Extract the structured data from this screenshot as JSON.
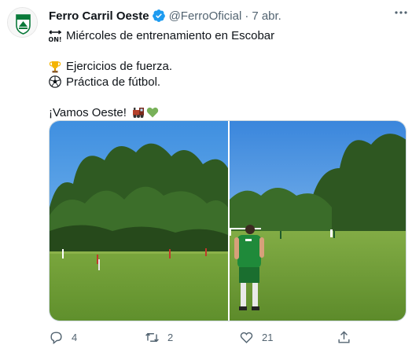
{
  "tweet": {
    "author_name": "Ferro Carril Oeste",
    "handle": "@FerroOficial",
    "separator": "·",
    "time": "7 abr.",
    "avatar_icon": "ferro-carril-oeste-crest",
    "verified_icon": "verified-badge-icon",
    "line1": "Miércoles de entrenamiento en Escobar",
    "line1_icon": "on-arrow-emoji",
    "line2": "Ejercicios de fuerza.",
    "line2_icon": "trophy-emoji",
    "line3": "Práctica de fútbol.",
    "line3_icon": "soccer-ball-emoji",
    "line4": "¡Vamos Oeste!",
    "line4_icons": [
      "locomotive-emoji",
      "green-heart-emoji"
    ]
  },
  "media": {
    "photos": [
      "training-field-wide",
      "training-field-player-back"
    ]
  },
  "actions": {
    "reply_count": "4",
    "retweet_count": "2",
    "like_count": "21"
  },
  "colors": {
    "text": "#0f1419",
    "muted": "#536471",
    "verified": "#1d9bf0",
    "ferro_green": "#0a7a3a"
  }
}
